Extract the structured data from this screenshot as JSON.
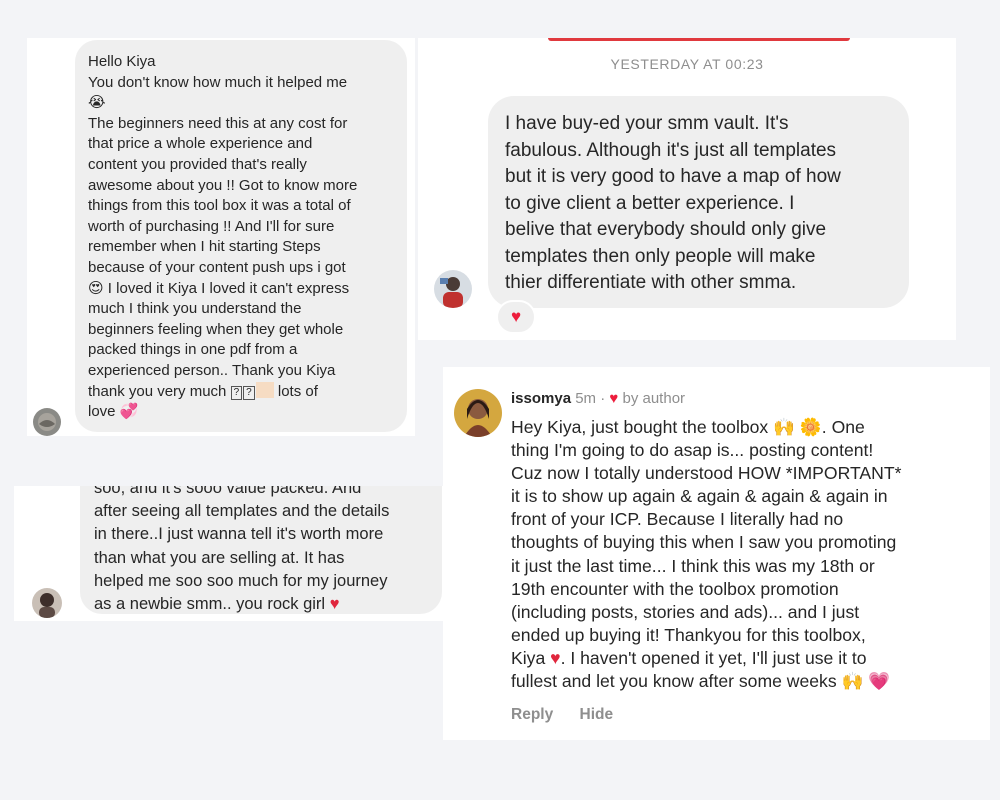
{
  "dm_left": {
    "lines": [
      "Hello Kiya",
      "You don't know how much it helped me",
      "😭",
      "The beginners need this at any cost for",
      "that price a whole experience and",
      "content you provided that's really",
      "awesome about you !! Got to know more",
      "things from this tool box it was a total of",
      "worth of purchasing !! And I'll for sure",
      "remember when I hit starting Steps",
      "because of your content push ups i got",
      "😍 I loved it Kiya I loved it can't express",
      "much I think you understand the",
      "beginners feeling when they get whole",
      "packed things in one pdf from a",
      "experienced person.. Thank you Kiya",
      "thank you very much",
      "lots of",
      "love 💞"
    ],
    "box_glyph": "?"
  },
  "dm_right": {
    "timestamp": "YESTERDAY AT 00:23",
    "lines": [
      "I have buy-ed your smm vault. It's",
      "fabulous. Although it's just all templates",
      "but it is very good to have a map of how",
      "to give client a better experience. I",
      "belive that everybody should only give",
      "templates then only people will make",
      "thier differentiate with other smma."
    ],
    "reaction": "♥"
  },
  "dm_partial": {
    "lines": [
      "soo, and it's sooo value packed. And",
      "after seeing all templates and the details",
      "in there..I just wanna tell it's worth more",
      "than what you are selling at. It has",
      "helped me soo soo much for my journey",
      "as a newbie smm.. you rock girl"
    ],
    "heart": "♥"
  },
  "comment": {
    "username": "issomya",
    "time": "5m",
    "separator": "·",
    "heart": "♥",
    "by_author": "by author",
    "lines": [
      "Hey Kiya, just bought the toolbox 🙌 🌼. One",
      "thing I'm going to do asap is... posting content!",
      "Cuz now I totally understood HOW *IMPORTANT*",
      "it is to show up again & again & again & again in",
      "front of your ICP. Because I literally had no",
      "thoughts of buying this when I saw you promoting",
      "it just the last time... I think this was my 18th or",
      "19th encounter with the toolbox promotion",
      "(including posts, stories and ads)... and I just",
      "ended up buying it! Thankyou for this toolbox,",
      "Kiya",
      ". I haven't opened it yet, I'll just use it to",
      "fullest and let you know after some weeks 🙌",
      "💗"
    ],
    "reply_label": "Reply",
    "hide_label": "Hide"
  }
}
